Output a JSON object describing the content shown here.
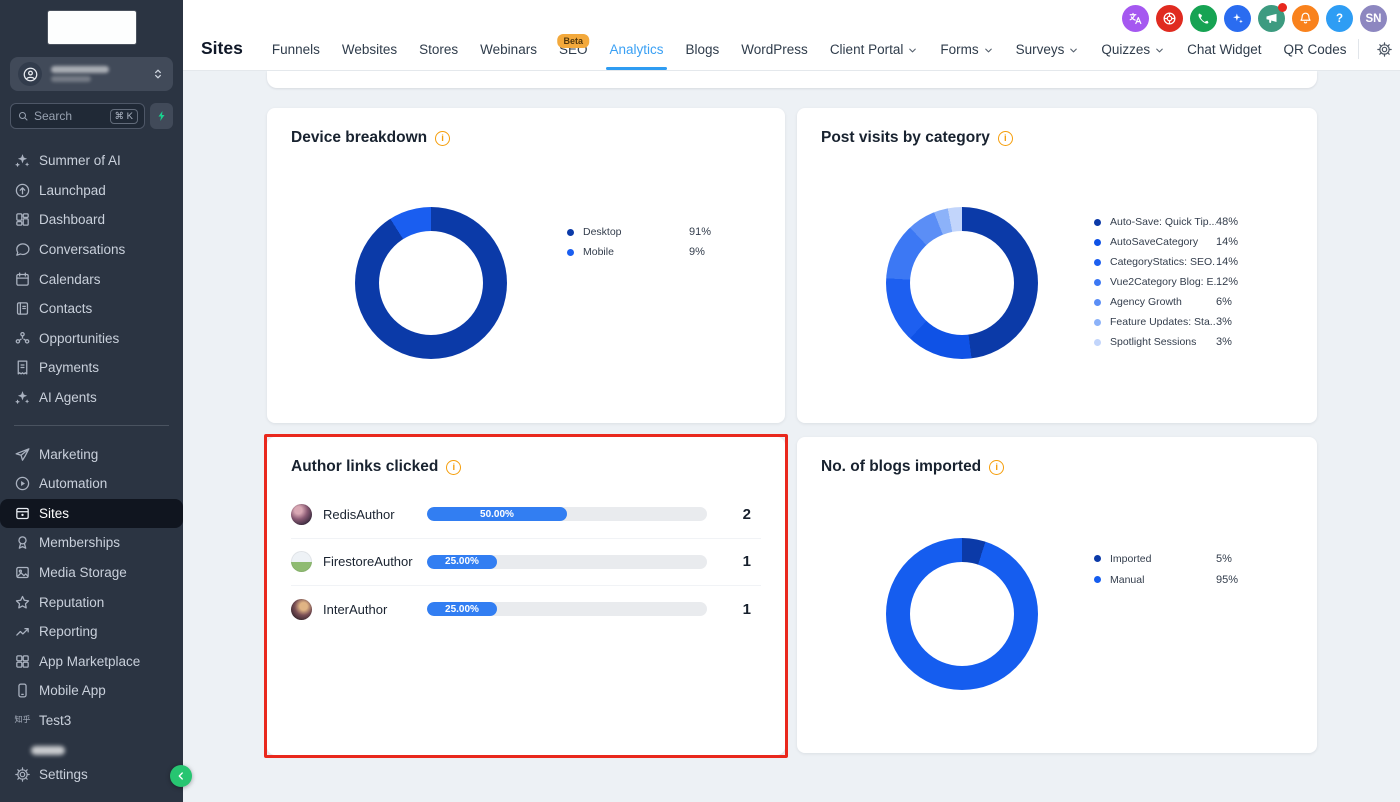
{
  "header": {
    "title": "Sites",
    "tabs": [
      {
        "label": "Funnels"
      },
      {
        "label": "Websites"
      },
      {
        "label": "Stores"
      },
      {
        "label": "Webinars"
      },
      {
        "label": "SEO",
        "badge": "Beta"
      },
      {
        "label": "Analytics",
        "active": true
      },
      {
        "label": "Blogs"
      },
      {
        "label": "WordPress"
      },
      {
        "label": "Client Portal",
        "chevron": true
      },
      {
        "label": "Forms",
        "chevron": true
      },
      {
        "label": "Surveys",
        "chevron": true
      },
      {
        "label": "Quizzes",
        "chevron": true
      },
      {
        "label": "Chat Widget"
      },
      {
        "label": "QR Codes"
      }
    ],
    "icons": [
      {
        "name": "translate-icon",
        "bg": "#a558f0",
        "symbol": "translate"
      },
      {
        "name": "support-ring-icon",
        "bg": "#e02b20",
        "symbol": "lifering"
      },
      {
        "name": "phone-icon",
        "bg": "#16a353",
        "symbol": "phone"
      },
      {
        "name": "ai-assistant-icon",
        "bg": "#2a6cf0",
        "symbol": "ai"
      },
      {
        "name": "announcements-icon",
        "bg": "#3d9b80",
        "symbol": "megaphone",
        "dot": true
      },
      {
        "name": "notifications-bell-icon",
        "bg": "#f9821d",
        "symbol": "bell"
      },
      {
        "name": "help-icon",
        "bg": "#2e9df4",
        "text": "?"
      },
      {
        "name": "user-avatar",
        "bg": "#8d87c0",
        "text": "SN"
      }
    ]
  },
  "sidebar": {
    "search": {
      "placeholder": "Search",
      "shortcut": "⌘ K"
    },
    "primary": [
      {
        "label": "Summer of AI",
        "icon": "sparkles"
      },
      {
        "label": "Launchpad",
        "icon": "launchpad"
      },
      {
        "label": "Dashboard",
        "icon": "dashboard"
      },
      {
        "label": "Conversations",
        "icon": "chat"
      },
      {
        "label": "Calendars",
        "icon": "calendar"
      },
      {
        "label": "Contacts",
        "icon": "contacts"
      },
      {
        "label": "Opportunities",
        "icon": "opportunities"
      },
      {
        "label": "Payments",
        "icon": "payments"
      },
      {
        "label": "AI Agents",
        "icon": "sparkles"
      }
    ],
    "secondary": [
      {
        "label": "Marketing",
        "icon": "plane"
      },
      {
        "label": "Automation",
        "icon": "automation"
      },
      {
        "label": "Sites",
        "icon": "browser",
        "active": true
      },
      {
        "label": "Memberships",
        "icon": "medal"
      },
      {
        "label": "Media Storage",
        "icon": "image"
      },
      {
        "label": "Reputation",
        "icon": "star"
      },
      {
        "label": "Reporting",
        "icon": "trend"
      },
      {
        "label": "App Marketplace",
        "icon": "grid4"
      },
      {
        "label": "Mobile App",
        "icon": "mobile"
      },
      {
        "label": "Test3",
        "icon_text": "知乎"
      },
      {
        "label": "",
        "redacted": true
      }
    ],
    "settings": {
      "label": "Settings"
    }
  },
  "cards": {
    "device": {
      "title": "Device breakdown"
    },
    "posts": {
      "title": "Post visits by category"
    },
    "authors": {
      "title": "Author links clicked"
    },
    "blogs": {
      "title": "No. of blogs imported"
    }
  },
  "chart_data": [
    {
      "type": "pie",
      "subtype": "donut",
      "title": "Device breakdown",
      "segments": [
        {
          "label": "Desktop",
          "value": 91,
          "pct": "91%",
          "color": "#0b3aa8"
        },
        {
          "label": "Mobile",
          "value": 9,
          "pct": "9%",
          "color": "#1a5ef0"
        }
      ]
    },
    {
      "type": "pie",
      "subtype": "donut",
      "title": "Post visits by category",
      "segments": [
        {
          "label": "Auto-Save: Quick Tip...",
          "value": 48,
          "pct": "48%",
          "color": "#0b3aa8"
        },
        {
          "label": "AutoSaveCategory",
          "value": 14,
          "pct": "14%",
          "color": "#0f52e6"
        },
        {
          "label": "CategoryStatics: SEO...",
          "value": 14,
          "pct": "14%",
          "color": "#1d5ff0"
        },
        {
          "label": "Vue2Category Blog: E...",
          "value": 12,
          "pct": "12%",
          "color": "#3c78f4"
        },
        {
          "label": "Agency Growth",
          "value": 6,
          "pct": "6%",
          "color": "#5b8ef6"
        },
        {
          "label": "Feature Updates: Sta...",
          "value": 3,
          "pct": "3%",
          "color": "#8cb2f9"
        },
        {
          "label": "Spotlight Sessions",
          "value": 3,
          "pct": "3%",
          "color": "#c2d5fb"
        }
      ]
    },
    {
      "type": "bar",
      "title": "Author links clicked",
      "rows": [
        {
          "name": "RedisAuthor",
          "pct": "50.00%",
          "count": "2",
          "avatar": "a1"
        },
        {
          "name": "FirestoreAuthor",
          "pct": "25.00%",
          "count": "1",
          "avatar": "a2"
        },
        {
          "name": "InterAuthor",
          "pct": "25.00%",
          "count": "1",
          "avatar": "a3"
        }
      ]
    },
    {
      "type": "pie",
      "subtype": "donut",
      "title": "No. of blogs imported",
      "segments": [
        {
          "label": "Imported",
          "value": 5,
          "pct": "5%",
          "color": "#0b3aa8"
        },
        {
          "label": "Manual",
          "value": 95,
          "pct": "95%",
          "color": "#155def"
        }
      ]
    }
  ]
}
